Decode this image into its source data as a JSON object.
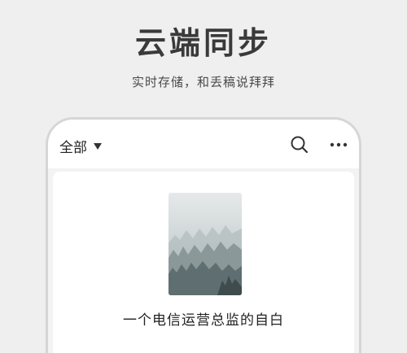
{
  "hero": {
    "title": "云端同步",
    "subtitle": "实时存储，和丢稿说拜拜"
  },
  "app_bar": {
    "filter_label": "全部",
    "icons": [
      "chevron-down-icon",
      "search-icon",
      "more-icon"
    ]
  },
  "documents": [
    {
      "title": "一个电信运营总监的自白"
    }
  ],
  "colors": {
    "background": "#efefef",
    "phone_frame": "#d6d6d6",
    "card": "#ffffff",
    "list_background": "#f3f3f4",
    "text": "#222222"
  }
}
